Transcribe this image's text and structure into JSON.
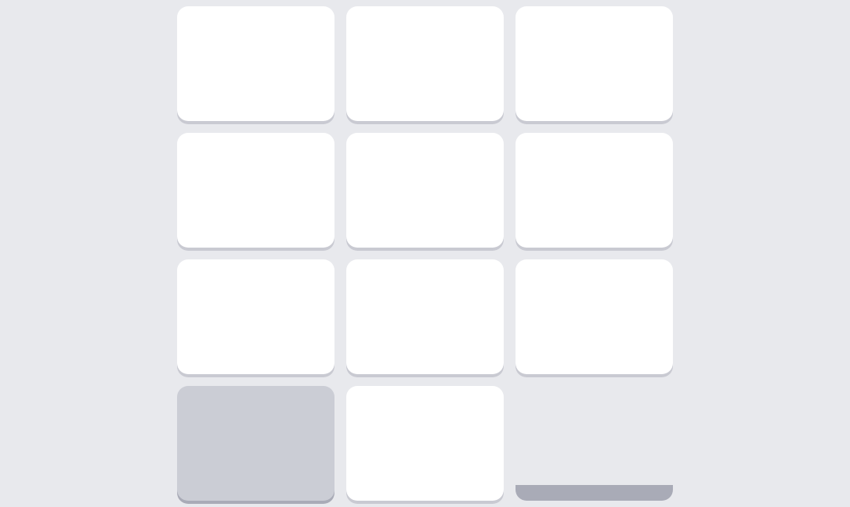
{
  "keypad": {
    "keys": [
      {
        "id": "key-1",
        "label": ""
      },
      {
        "id": "key-2",
        "label": ""
      },
      {
        "id": "key-3",
        "label": ""
      },
      {
        "id": "key-4",
        "label": ""
      },
      {
        "id": "key-5",
        "label": ""
      },
      {
        "id": "key-6",
        "label": ""
      },
      {
        "id": "key-7",
        "label": ""
      },
      {
        "id": "key-8",
        "label": ""
      },
      {
        "id": "key-9",
        "label": ""
      },
      {
        "id": "key-special",
        "label": ""
      },
      {
        "id": "key-0",
        "label": ""
      },
      {
        "id": "key-action",
        "label": ""
      }
    ],
    "colors": {
      "background": "#e8e9ed",
      "key": "#ffffff",
      "key_shadow": "#c9cad2",
      "key_alt": "#cbcdd5",
      "key_alt_shadow": "#a9abb7"
    }
  }
}
